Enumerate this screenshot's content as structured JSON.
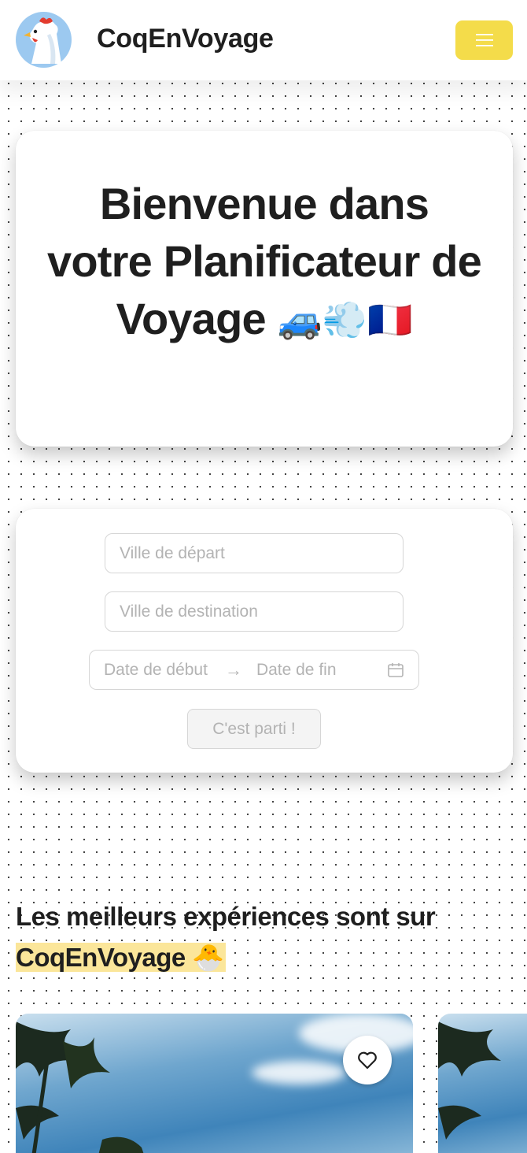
{
  "header": {
    "brand": "CoqEnVoyage",
    "logo_icon": "rooster-icon",
    "menu_icon": "hamburger-menu-icon",
    "accent_color": "#f4dc4a"
  },
  "hero": {
    "title": "Bienvenue dans votre Planificateur de Voyage",
    "emoji": "🚙💨🇫🇷"
  },
  "search_form": {
    "departure_placeholder": "Ville de départ",
    "destination_placeholder": "Ville de destination",
    "start_date_placeholder": "Date de début",
    "end_date_placeholder": "Date de fin",
    "date_separator": "→",
    "submit_label": "C'est parti !",
    "calendar_icon": "calendar-icon"
  },
  "experiences": {
    "title_prefix": "Les meilleurs expériences sont sur",
    "title_highlight": "CoqEnVoyage 🐣",
    "highlight_color": "#fbe69a",
    "cards": [
      {
        "image": "palm-trees-sky-photo",
        "favorite_icon": "heart-icon"
      },
      {
        "image": "palm-trees-sky-photo"
      }
    ]
  }
}
